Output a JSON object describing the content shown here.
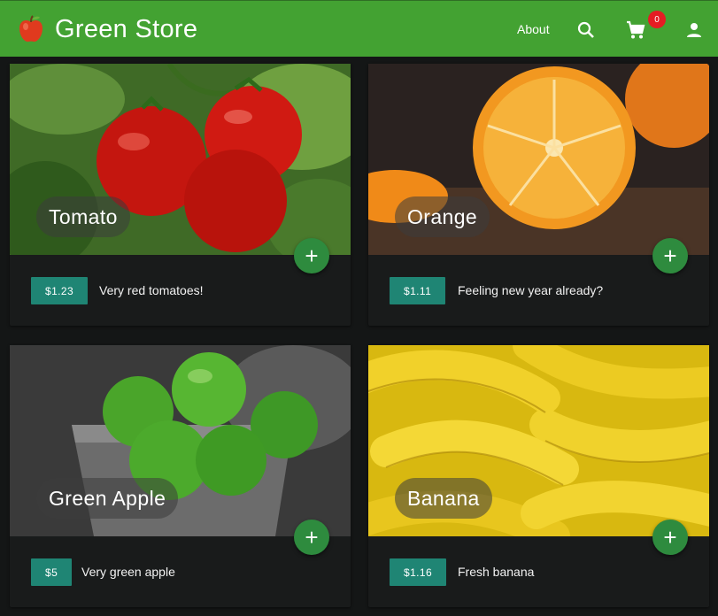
{
  "app": {
    "title": "Green Store",
    "logo_icon": "apple-emoji",
    "brand_color": "#43a232"
  },
  "header": {
    "about_label": "About",
    "search_icon": "search-icon",
    "cart_icon": "cart-icon",
    "cart_count": "0",
    "account_icon": "account-icon"
  },
  "products": [
    {
      "name": "Tomato",
      "price": "$1.23",
      "description": "Very red tomatoes!",
      "add_icon": "plus-icon"
    },
    {
      "name": "Orange",
      "price": "$1.11",
      "description": "Feeling new year already?",
      "add_icon": "plus-icon"
    },
    {
      "name": "Green Apple",
      "price": "$5",
      "description": "Very green apple",
      "add_icon": "plus-icon"
    },
    {
      "name": "Banana",
      "price": "$1.16",
      "description": "Fresh banana",
      "add_icon": "plus-icon"
    }
  ],
  "colors": {
    "price_chip": "#1f8574",
    "fab": "#2e8b3e",
    "badge": "#e51c23",
    "card_bg": "#191b1b",
    "page_bg": "#141616"
  }
}
